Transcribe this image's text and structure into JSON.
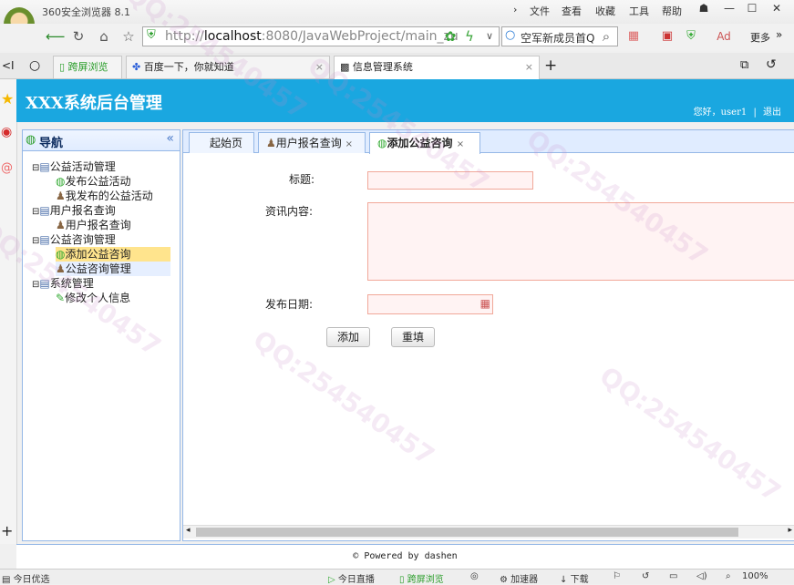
{
  "browser": {
    "title": "360安全浏览器 8.1",
    "menu": [
      "文件",
      "查看",
      "收藏",
      "工具",
      "帮助"
    ],
    "url_prefix": "http://",
    "url_host": "localhost",
    "url_rest": ":8080/JavaWebProject/main_zu",
    "search_text": "空军新成员首Q",
    "more_label": "更多",
    "tabs": [
      {
        "label": " 跨屏浏览"
      },
      {
        "label": "百度一下，你就知道"
      },
      {
        "label": "信息管理系统"
      }
    ]
  },
  "app": {
    "title": "XXX系统后台管理",
    "greeting": "您好，user1",
    "separator": "|",
    "logout": "退出"
  },
  "nav": {
    "title": "导航",
    "tree": [
      {
        "label": "公益活动管理",
        "level": 0
      },
      {
        "label": "发布公益活动",
        "level": 1
      },
      {
        "label": "我发布的公益活动",
        "level": 1
      },
      {
        "label": "用户报名查询",
        "level": 0
      },
      {
        "label": "用户报名查询",
        "level": 1
      },
      {
        "label": "公益咨询管理",
        "level": 0
      },
      {
        "label": "添加公益咨询",
        "level": 1
      },
      {
        "label": "公益咨询管理",
        "level": 1
      },
      {
        "label": "系统管理",
        "level": 0
      },
      {
        "label": "修改个人信息",
        "level": 1
      }
    ]
  },
  "main": {
    "tabs": [
      {
        "label": "起始页"
      },
      {
        "label": "用户报名查询"
      },
      {
        "label": "添加公益咨询"
      }
    ],
    "form": {
      "title_label": "标题:",
      "content_label": "资讯内容:",
      "date_label": "发布日期:",
      "add_button": "添加",
      "reset_button": "重填"
    }
  },
  "footer": {
    "text": "Powered by dashen"
  },
  "status": {
    "left": "今日优选",
    "items": [
      "今日直播",
      "跨屏浏览",
      "加速器",
      "下载"
    ],
    "zoom": "100%"
  }
}
